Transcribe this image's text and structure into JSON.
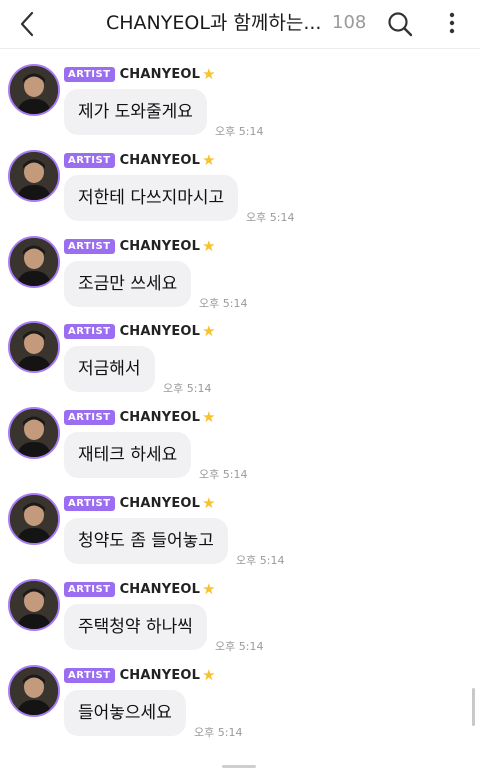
{
  "header": {
    "back_icon": "chevron-left-icon",
    "title": "CHANYEOL과 함께하는...",
    "member_count": "108",
    "search_icon": "search-icon",
    "more_icon": "more-vertical-icon"
  },
  "colors": {
    "artist_badge": "#9b6df0",
    "avatar_ring": "#a77cf6",
    "bubble": "#f1f1f3",
    "star": "#f6c32f"
  },
  "messages": [
    {
      "badge": "ARTIST",
      "sender": "CHANYEOL",
      "text": "제가 도와줄게요",
      "time": "오후 5:14"
    },
    {
      "badge": "ARTIST",
      "sender": "CHANYEOL",
      "text": "저한테 다쓰지마시고",
      "time": "오후 5:14"
    },
    {
      "badge": "ARTIST",
      "sender": "CHANYEOL",
      "text": "조금만 쓰세요",
      "time": "오후 5:14"
    },
    {
      "badge": "ARTIST",
      "sender": "CHANYEOL",
      "text": "저금해서",
      "time": "오후 5:14"
    },
    {
      "badge": "ARTIST",
      "sender": "CHANYEOL",
      "text": "재테크 하세요",
      "time": "오후 5:14"
    },
    {
      "badge": "ARTIST",
      "sender": "CHANYEOL",
      "text": "청약도 좀 들어놓고",
      "time": "오후 5:14"
    },
    {
      "badge": "ARTIST",
      "sender": "CHANYEOL",
      "text": "주택청약 하나씩",
      "time": "오후 5:14"
    },
    {
      "badge": "ARTIST",
      "sender": "CHANYEOL",
      "text": "들어놓으세요",
      "time": "오후 5:14"
    }
  ]
}
